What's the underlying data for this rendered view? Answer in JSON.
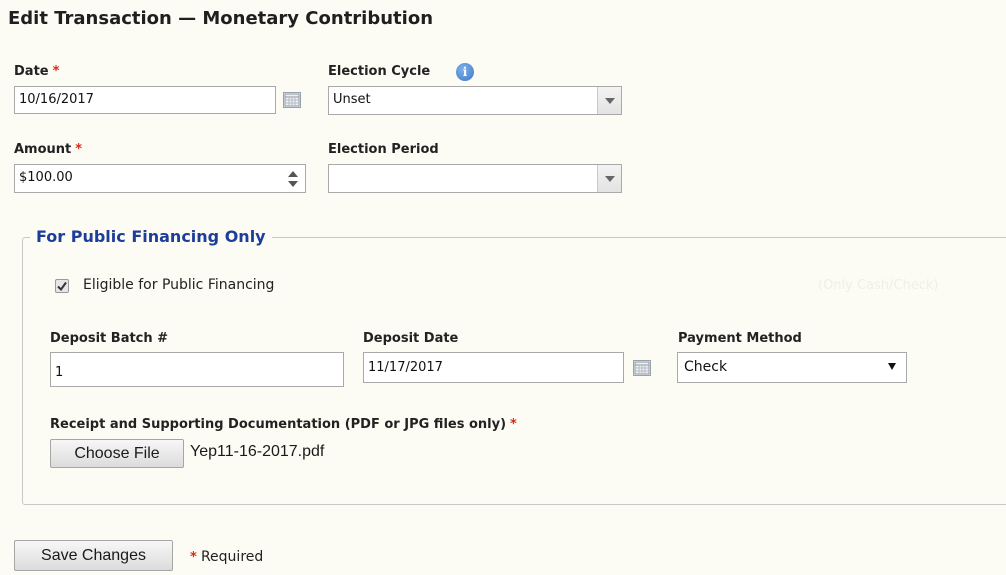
{
  "page": {
    "title": "Edit Transaction — Monetary Contribution"
  },
  "form": {
    "required_marker": "*",
    "date": {
      "label": "Date",
      "value": "10/16/2017"
    },
    "election_cycle": {
      "label": "Election Cycle",
      "selected": "Unset",
      "info_icon": "info-icon"
    },
    "amount": {
      "label": "Amount",
      "value": "$100.00"
    },
    "election_period": {
      "label": "Election Period",
      "selected": ""
    }
  },
  "public_financing": {
    "legend": "For Public Financing Only",
    "eligible_checkbox": {
      "label": "Eligible for Public Financing",
      "checked": true
    },
    "faded_note": "(Only Cash/Check)",
    "deposit_batch": {
      "label": "Deposit Batch #",
      "value": "1"
    },
    "deposit_date": {
      "label": "Deposit Date",
      "value": "11/17/2017"
    },
    "payment_method": {
      "label": "Payment Method",
      "selected": "Check"
    },
    "receipt": {
      "label": "Receipt and Supporting Documentation (PDF or JPG files only)",
      "choose_button": "Choose File",
      "file_name": "Yep11-16-2017.pdf"
    }
  },
  "footer": {
    "save_button": "Save Changes",
    "required_note": "Required"
  },
  "colors": {
    "background": "#fcfcf4",
    "required": "#d8261c",
    "legend": "#1d3d9a",
    "info_icon": "#3b78c4"
  }
}
